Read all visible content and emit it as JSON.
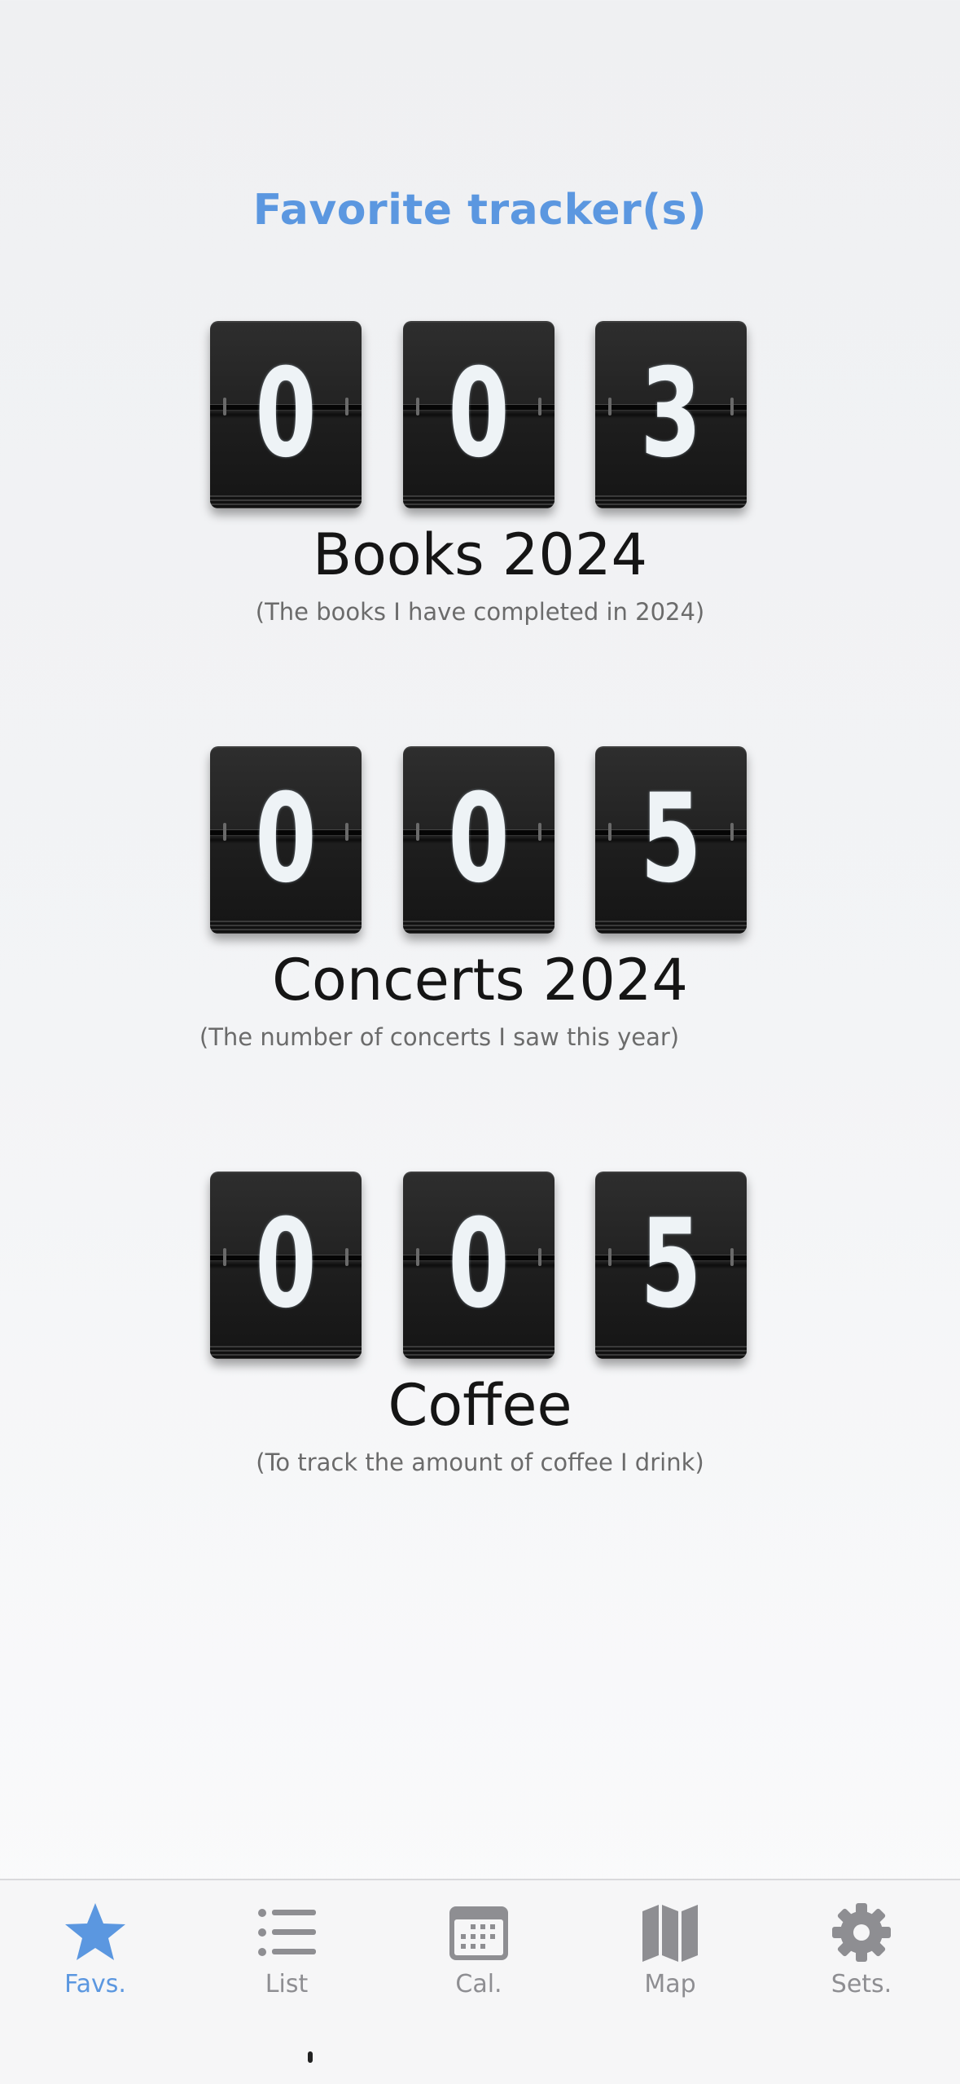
{
  "page": {
    "title": "Favorite tracker(s)"
  },
  "trackers": [
    {
      "digits": [
        "0",
        "0",
        "3"
      ],
      "name": "Books 2024",
      "description": "(The books I have completed in 2024)"
    },
    {
      "digits": [
        "0",
        "0",
        "5"
      ],
      "name": "Concerts 2024",
      "description": "(The number of concerts I saw this year)"
    },
    {
      "digits": [
        "0",
        "0",
        "5"
      ],
      "name": "Coffee",
      "description": "(To track the amount of coffee I drink)"
    }
  ],
  "tabbar": {
    "tabs": [
      {
        "label": "Favs.",
        "icon": "star-icon",
        "active": true
      },
      {
        "label": "List",
        "icon": "list-icon",
        "active": false
      },
      {
        "label": "Cal.",
        "icon": "calendar-icon",
        "active": false
      },
      {
        "label": "Map",
        "icon": "map-icon",
        "active": false
      },
      {
        "label": "Sets.",
        "icon": "gear-icon",
        "active": false
      }
    ]
  },
  "colors": {
    "accent": "#5b97e0",
    "inactive_tab": "#8e8e92",
    "flip_card": "#1e1e1e",
    "digit": "#eef3f6"
  }
}
